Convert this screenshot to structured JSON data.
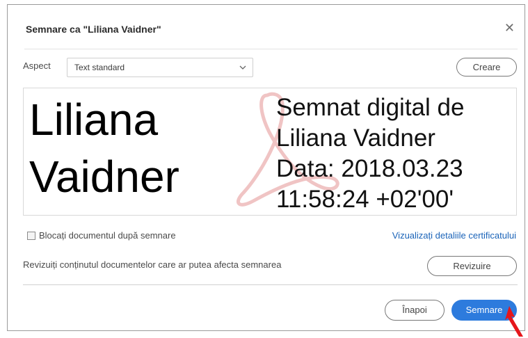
{
  "dialog": {
    "title": "Semnare ca \"Liliana Vaidner\"",
    "close_icon": "close-icon"
  },
  "aspect": {
    "label": "Aspect",
    "selected": "Text standard",
    "create_label": "Creare"
  },
  "signature_preview": {
    "name_line1": "Liliana",
    "name_line2": "Vaidner",
    "detail_lines": [
      "Semnat digital de",
      "Liliana Vaidner",
      "Data: 2018.03.23",
      "11:58:24 +02'00'"
    ],
    "watermark_icon": "adobe-acrobat-watermark-icon"
  },
  "options": {
    "lock_document_label": "Blocați documentul după semnare",
    "lock_document_checked": false,
    "certificate_link": "Vizualizați detaliile certificatului",
    "review_text": "Revizuiți conținutul documentelor care ar putea afecta semnarea",
    "review_button": "Revizuire"
  },
  "footer": {
    "back_button": "Înapoi",
    "sign_button": "Semnare"
  },
  "colors": {
    "primary_button": "#2d7bdd",
    "link": "#1a63b8",
    "annotation_arrow": "#e5161b",
    "watermark": "#e8a4a4"
  }
}
